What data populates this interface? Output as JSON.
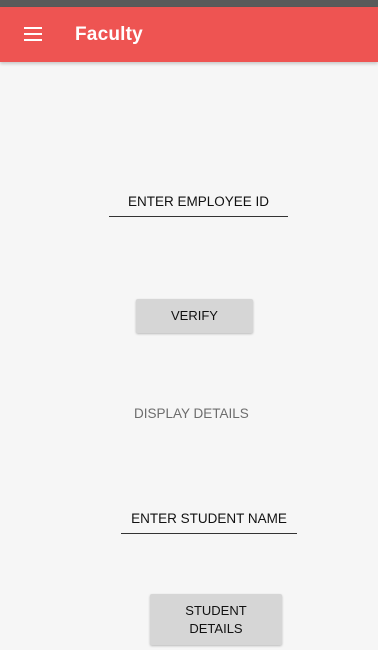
{
  "app_bar": {
    "title": "Faculty",
    "menu_icon": "hamburger-menu-icon",
    "color": "#ee5452"
  },
  "employee_id_field": {
    "placeholder": "ENTER EMPLOYEE ID"
  },
  "verify_button": {
    "label": "VERIFY"
  },
  "display_details": {
    "text": "DISPLAY DETAILS"
  },
  "student_name_field": {
    "placeholder": "ENTER STUDENT NAME"
  },
  "student_details_button": {
    "line1": "STUDENT",
    "line2": "DETAILS"
  }
}
